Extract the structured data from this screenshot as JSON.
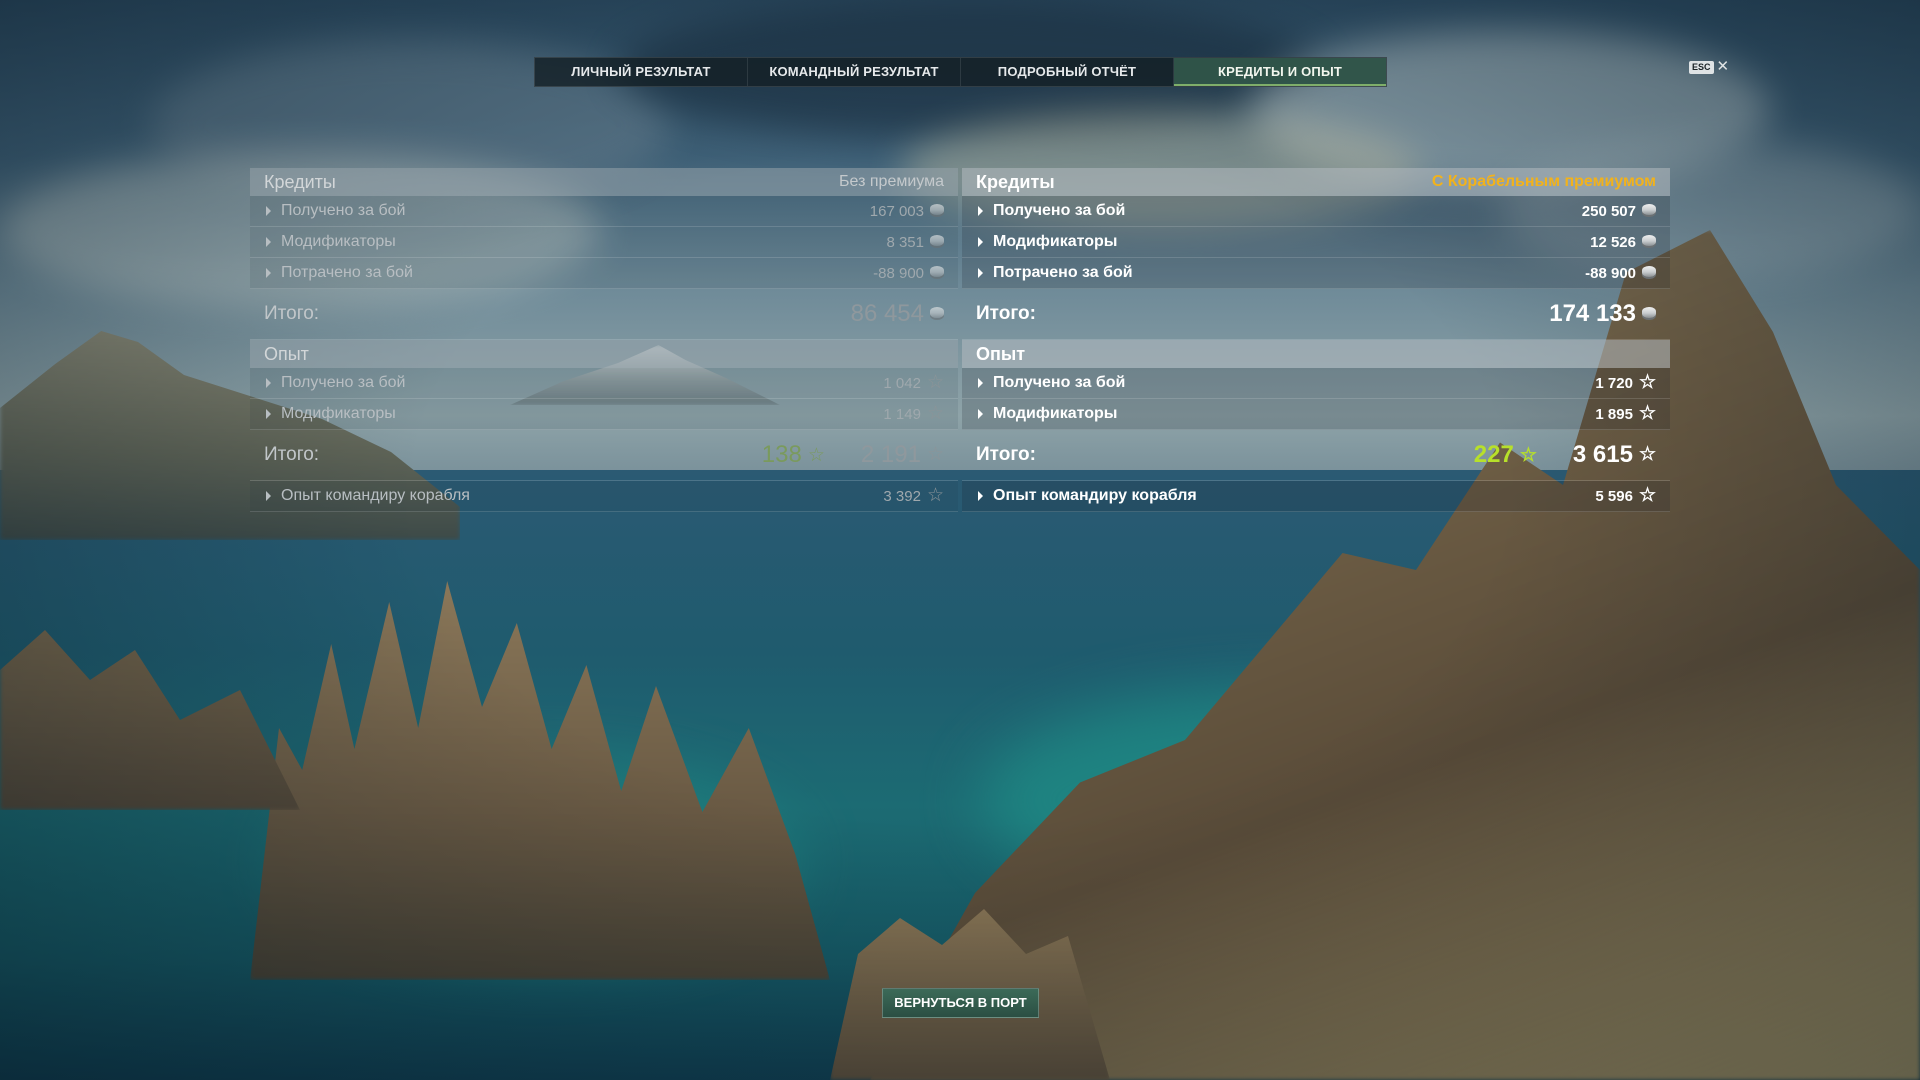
{
  "tabs": [
    {
      "label": "ЛИЧНЫЙ РЕЗУЛЬТАТ",
      "active": false
    },
    {
      "label": "КОМАНДНЫЙ РЕЗУЛЬТАТ",
      "active": false
    },
    {
      "label": "ПОДРОБНЫЙ ОТЧЁТ",
      "active": false
    },
    {
      "label": "КРЕДИТЫ И ОПЫТ",
      "active": true
    }
  ],
  "esc": {
    "key": "ESC",
    "close_glyph": "✕"
  },
  "icons": {
    "credit": "credit-coin-icon",
    "xp": "star-icon",
    "expand": "triangle-right-icon"
  },
  "colors": {
    "premium": "#f2b21b",
    "xp_green": "#b7e02a"
  },
  "left": {
    "credits": {
      "title": "Кредиты",
      "subtitle": "Без премиума",
      "rows": [
        {
          "label": "Получено за бой",
          "value": "167 003"
        },
        {
          "label": "Модификаторы",
          "value": "8 351"
        },
        {
          "label": "Потрачено за бой",
          "value": "-88 900"
        }
      ],
      "total_label": "Итого:",
      "total": "86 454"
    },
    "xp": {
      "title": "Опыт",
      "rows": [
        {
          "label": "Получено за бой",
          "value": "1 042"
        },
        {
          "label": "Модификаторы",
          "value": "1 149"
        }
      ],
      "total_label": "Итого:",
      "total_free": "138",
      "total": "2 191",
      "commander_label": "Опыт командиру корабля",
      "commander": "3 392"
    }
  },
  "right": {
    "credits": {
      "title": "Кредиты",
      "subtitle": "С Корабельным премиумом",
      "rows": [
        {
          "label": "Получено за бой",
          "value": "250 507"
        },
        {
          "label": "Модификаторы",
          "value": "12 526"
        },
        {
          "label": "Потрачено за бой",
          "value": "-88 900"
        }
      ],
      "total_label": "Итого:",
      "total": "174 133"
    },
    "xp": {
      "title": "Опыт",
      "rows": [
        {
          "label": "Получено за бой",
          "value": "1 720"
        },
        {
          "label": "Модификаторы",
          "value": "1 895"
        }
      ],
      "total_label": "Итого:",
      "total_free": "227",
      "total": "3 615",
      "commander_label": "Опыт командиру корабля",
      "commander": "5 596"
    }
  },
  "footer": {
    "return_button": "ВЕРНУТЬСЯ В ПОРТ"
  }
}
